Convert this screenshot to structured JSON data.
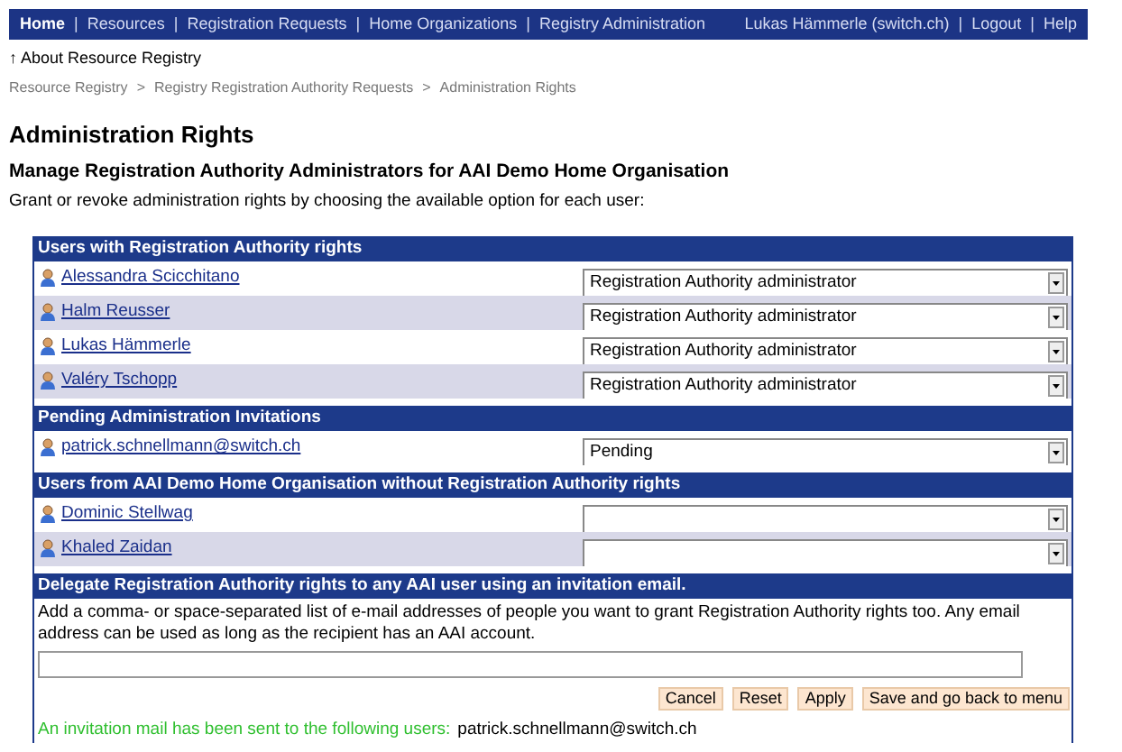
{
  "nav": {
    "items": [
      {
        "label": "Home",
        "selected": true
      },
      {
        "label": "Resources",
        "selected": false
      },
      {
        "label": "Registration Requests",
        "selected": false
      },
      {
        "label": "Home Organizations",
        "selected": false
      },
      {
        "label": "Registry Administration",
        "selected": false
      }
    ],
    "user": "Lukas Hämmerle (switch.ch)",
    "links": [
      "Logout",
      "Help"
    ],
    "separator": "|"
  },
  "up_link": {
    "arrow": "↑",
    "label": "About Resource Registry"
  },
  "breadcrumb": [
    "Resource Registry",
    "Registry Registration Authority Requests",
    "Administration Rights"
  ],
  "breadcrumb_separator": ">",
  "title": "Administration Rights",
  "subtitle": "Manage Registration Authority Administrators for AAI Demo Home Organisation",
  "intro": "Grant or revoke administration rights by choosing the available option for each user:",
  "sections": [
    {
      "kind": "users",
      "header": "Users with Registration Authority rights",
      "rows": [
        {
          "name": "Alessandra Scicchitano",
          "value": "Registration Authority administrator"
        },
        {
          "name": "Halm Reusser",
          "value": "Registration Authority administrator"
        },
        {
          "name": "Lukas Hämmerle",
          "value": "Registration Authority administrator"
        },
        {
          "name": "Valéry Tschopp",
          "value": "Registration Authority administrator"
        }
      ]
    },
    {
      "kind": "users",
      "header": "Pending Administration Invitations",
      "rows": [
        {
          "name": "patrick.schnellmann@switch.ch",
          "value": "Pending"
        }
      ]
    },
    {
      "kind": "users",
      "header": "Users from AAI Demo Home Organisation without Registration Authority rights",
      "rows": [
        {
          "name": "Dominic Stellwag"
        },
        {
          "name": "Khaled Zaidan"
        }
      ]
    },
    {
      "kind": "invite",
      "header": "Delegate Registration Authority rights to any AAI user using an invitation email.",
      "text": "Add a comma- or space-separated list of e-mail addresses of people you want to grant Registration Authority rights too. Any email address can be used as long as the recipient has an AAI account.",
      "buttons": [
        "Cancel",
        "Reset",
        "Apply",
        "Save and go back to menu"
      ],
      "message": {
        "label": "An invitation mail has been sent to the following users:",
        "recipients": "patrick.schnellmann@switch.ch"
      }
    }
  ]
}
